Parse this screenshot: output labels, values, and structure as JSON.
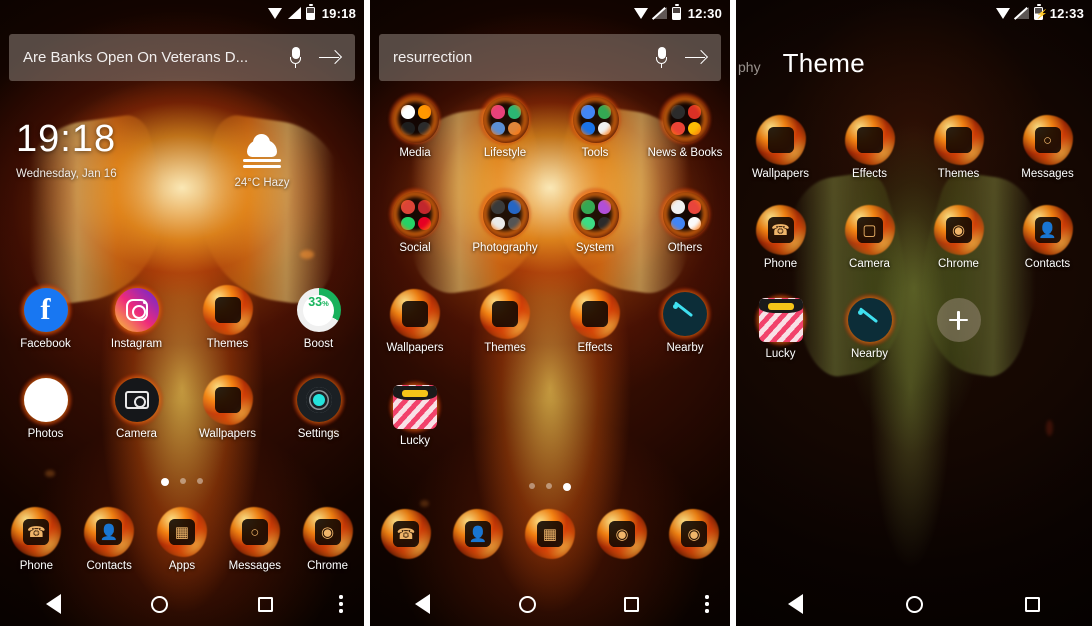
{
  "screens": [
    {
      "id": "home-screen",
      "status": {
        "time": "19:18",
        "wifi": "wifi-icon",
        "signal": "signal-icon",
        "battery": "battery-icon"
      },
      "search": {
        "query": "Are Banks Open On Veterans D...",
        "mic": "microphone-icon",
        "go": "arrow-right-icon"
      },
      "clock": {
        "time": "19:18",
        "date": "Wednesday, Jan 16",
        "weather": "24°C Hazy",
        "weather_icon": "fog-cloud-icon"
      },
      "apps": [
        {
          "label": "Facebook",
          "icon": "facebook-icon"
        },
        {
          "label": "Instagram",
          "icon": "instagram-icon"
        },
        {
          "label": "Themes",
          "icon": "themes-icon"
        },
        {
          "label": "Boost",
          "icon": "boost-ring-icon",
          "value": "33",
          "unit": "%"
        },
        {
          "label": "Photos",
          "icon": "google-photos-icon"
        },
        {
          "label": "Camera",
          "icon": "camera-icon"
        },
        {
          "label": "Wallpapers",
          "icon": "wallpapers-icon"
        },
        {
          "label": "Settings",
          "icon": "settings-gear-icon"
        }
      ],
      "dock": [
        {
          "label": "Phone",
          "icon": "phone-icon"
        },
        {
          "label": "Contacts",
          "icon": "contacts-icon"
        },
        {
          "label": "Apps",
          "icon": "apps-grid-icon"
        },
        {
          "label": "Messages",
          "icon": "messages-icon"
        },
        {
          "label": "Chrome",
          "icon": "chrome-icon"
        }
      ],
      "dots": {
        "count": 3,
        "active": 0
      },
      "nav": {
        "back": "back-triangle-icon",
        "home": "home-circle-icon",
        "recents": "recents-square-icon",
        "more": "overflow-menu-icon",
        "has_more": true
      }
    },
    {
      "id": "app-drawer-screen",
      "status": {
        "time": "12:30",
        "wifi": "wifi-icon",
        "signal": "signal-off-icon",
        "battery": "battery-icon"
      },
      "search": {
        "query": "resurrection",
        "mic": "microphone-icon",
        "go": "arrow-right-icon"
      },
      "apps": [
        {
          "label": "Media",
          "icon": "folder-media-icon"
        },
        {
          "label": "Lifestyle",
          "icon": "folder-lifestyle-icon"
        },
        {
          "label": "Tools",
          "icon": "folder-tools-icon"
        },
        {
          "label": "News & Books",
          "icon": "folder-news-books-icon"
        },
        {
          "label": "Social",
          "icon": "folder-social-icon"
        },
        {
          "label": "Photography",
          "icon": "folder-photography-icon"
        },
        {
          "label": "System",
          "icon": "folder-system-icon"
        },
        {
          "label": "Others",
          "icon": "folder-others-icon"
        },
        {
          "label": "Wallpapers",
          "icon": "wallpapers-icon"
        },
        {
          "label": "Themes",
          "icon": "themes-icon"
        },
        {
          "label": "Effects",
          "icon": "effects-icon"
        },
        {
          "label": "Nearby",
          "icon": "nearby-gauge-icon"
        },
        {
          "label": "Lucky",
          "icon": "lucky-icon"
        }
      ],
      "dock": [
        {
          "label": "",
          "icon": "phone-icon"
        },
        {
          "label": "",
          "icon": "contacts-icon"
        },
        {
          "label": "",
          "icon": "apps-grid-icon"
        },
        {
          "label": "",
          "icon": "chrome-icon"
        },
        {
          "label": "",
          "icon": "camera-icon"
        }
      ],
      "dots": {
        "count": 3,
        "active": 2
      },
      "nav": {
        "back": "back-triangle-icon",
        "home": "home-circle-icon",
        "recents": "recents-square-icon",
        "more": "overflow-menu-icon",
        "has_more": true
      }
    },
    {
      "id": "theme-category-screen",
      "status": {
        "time": "12:33",
        "wifi": "wifi-icon",
        "signal": "signal-off-icon",
        "battery": "battery-charging-icon"
      },
      "header": {
        "previous": "phy",
        "current": "Theme"
      },
      "apps": [
        {
          "label": "Wallpapers",
          "icon": "wallpapers-icon"
        },
        {
          "label": "Effects",
          "icon": "effects-icon"
        },
        {
          "label": "Themes",
          "icon": "themes-icon"
        },
        {
          "label": "Messages",
          "icon": "messages-icon"
        },
        {
          "label": "Phone",
          "icon": "phone-icon"
        },
        {
          "label": "Camera",
          "icon": "camera-icon"
        },
        {
          "label": "Chrome",
          "icon": "chrome-icon"
        },
        {
          "label": "Contacts",
          "icon": "contacts-icon"
        },
        {
          "label": "Lucky",
          "icon": "lucky-icon"
        },
        {
          "label": "Nearby",
          "icon": "nearby-gauge-icon"
        }
      ],
      "add_button": {
        "label": "+",
        "icon": "plus-icon"
      },
      "nav": {
        "back": "back-triangle-icon",
        "home": "home-circle-icon",
        "recents": "recents-square-icon",
        "has_more": false
      }
    }
  ],
  "colors": {
    "accent_green": "#19b45e",
    "fire_orange": "#ff7a14",
    "nearby_cyan": "#3fe0f0"
  }
}
